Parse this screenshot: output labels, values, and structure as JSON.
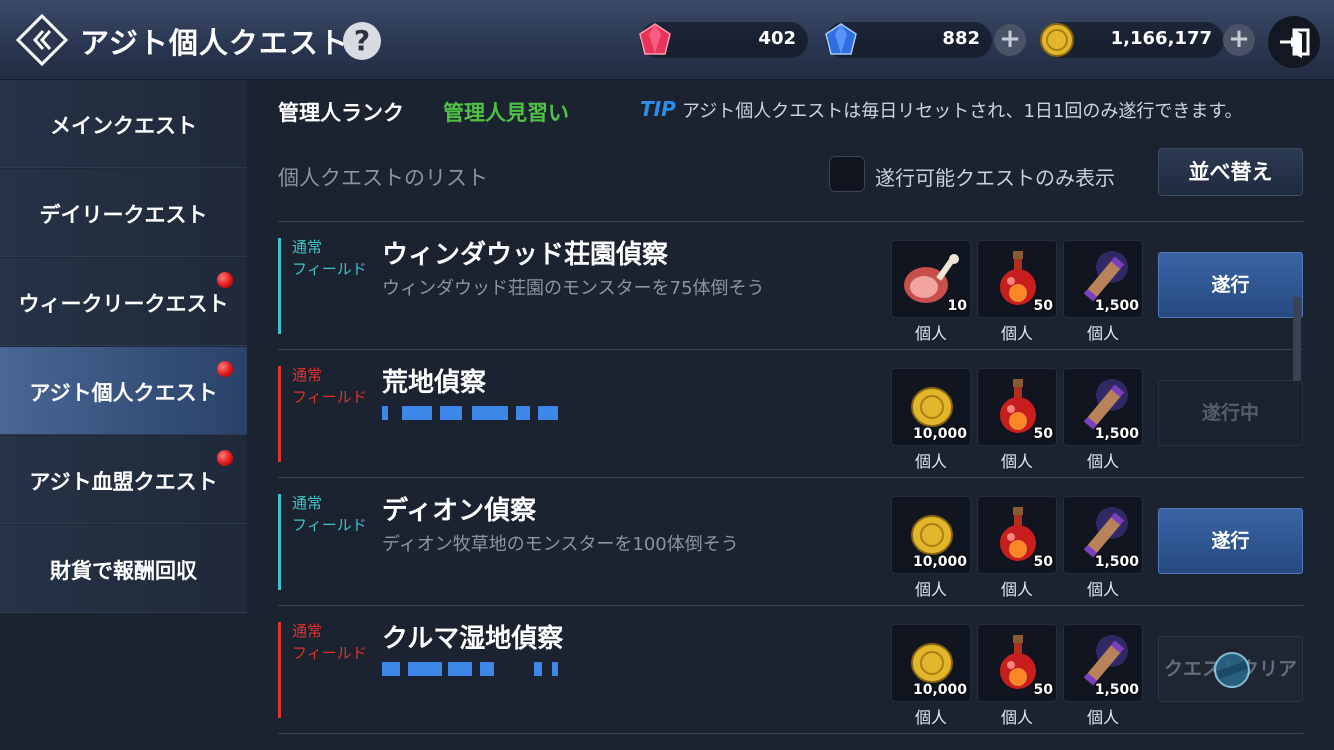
{
  "header": {
    "title": "アジト個人クエスト",
    "help_label": "?",
    "currencies": [
      {
        "icon": "red-gem-icon",
        "value": "402",
        "has_plus": false
      },
      {
        "icon": "blue-gem-icon",
        "value": "882",
        "has_plus": true
      },
      {
        "icon": "gold-coin-icon",
        "value": "1,166,177",
        "has_plus": true
      }
    ],
    "plus_label": "+"
  },
  "sidebar": {
    "items": [
      {
        "label": "メインクエスト",
        "active": false,
        "notice": false
      },
      {
        "label": "デイリークエスト",
        "active": false,
        "notice": false
      },
      {
        "label": "ウィークリークエスト",
        "active": false,
        "notice": true
      },
      {
        "label": "アジト個人クエスト",
        "active": true,
        "notice": true
      },
      {
        "label": "アジト血盟クエスト",
        "active": false,
        "notice": true
      },
      {
        "label": "財貨で報酬回収",
        "active": false,
        "notice": false
      }
    ]
  },
  "main": {
    "rank_label": "管理人ランク",
    "rank_value": "管理人見習い",
    "tip_tag": "TIP",
    "tip_text": "アジト個人クエストは毎日リセットされ、1日1回のみ遂行できます。",
    "list_label": "個人クエストのリスト",
    "filter_label": "遂行可能クエストのみ表示",
    "filter_checked": false,
    "sort_label": "並べ替え"
  },
  "quests": [
    {
      "type1": "通常",
      "type2": "フィールド",
      "accent": "#3fc1c9",
      "title": "ウィンダウッド荘園偵察",
      "desc": "ウィンダウッド荘園のモンスターを75体倒そう",
      "rewards": [
        {
          "icon": "meat-icon",
          "qty": "10",
          "label": "個人"
        },
        {
          "icon": "red-potion-icon",
          "qty": "50",
          "label": "個人"
        },
        {
          "icon": "scroll-icon",
          "qty": "1,500",
          "label": "個人"
        }
      ],
      "button": "遂行",
      "state": "go"
    },
    {
      "type1": "通常",
      "type2": "フィールド",
      "accent": "#e0322e",
      "title": "荒地偵察",
      "desc": "",
      "rewards": [
        {
          "icon": "gold-coin-icon",
          "qty": "10,000",
          "label": "個人"
        },
        {
          "icon": "red-potion-icon",
          "qty": "50",
          "label": "個人"
        },
        {
          "icon": "scroll-icon",
          "qty": "1,500",
          "label": "個人"
        }
      ],
      "button": "遂行中",
      "state": "doing"
    },
    {
      "type1": "通常",
      "type2": "フィールド",
      "accent": "#3fc1c9",
      "title": "ディオン偵察",
      "desc": "ディオン牧草地のモンスターを100体倒そう",
      "rewards": [
        {
          "icon": "gold-coin-icon",
          "qty": "10,000",
          "label": "個人"
        },
        {
          "icon": "red-potion-icon",
          "qty": "50",
          "label": "個人"
        },
        {
          "icon": "scroll-icon",
          "qty": "1,500",
          "label": "個人"
        }
      ],
      "button": "遂行",
      "state": "go"
    },
    {
      "type1": "通常",
      "type2": "フィールド",
      "accent": "#e0322e",
      "title": "クルマ湿地偵察",
      "desc": "",
      "rewards": [
        {
          "icon": "gold-coin-icon",
          "qty": "10,000",
          "label": "個人"
        },
        {
          "icon": "red-potion-icon",
          "qty": "50",
          "label": "個人"
        },
        {
          "icon": "scroll-icon",
          "qty": "1,500",
          "label": "個人"
        }
      ],
      "button": "クエストクリア",
      "state": "done"
    }
  ],
  "colors": {
    "accent_field_blue": "#3fc1c9",
    "accent_field_red": "#e0322e",
    "rank_green": "#4fc244",
    "tip_blue": "#2f8fe8"
  }
}
